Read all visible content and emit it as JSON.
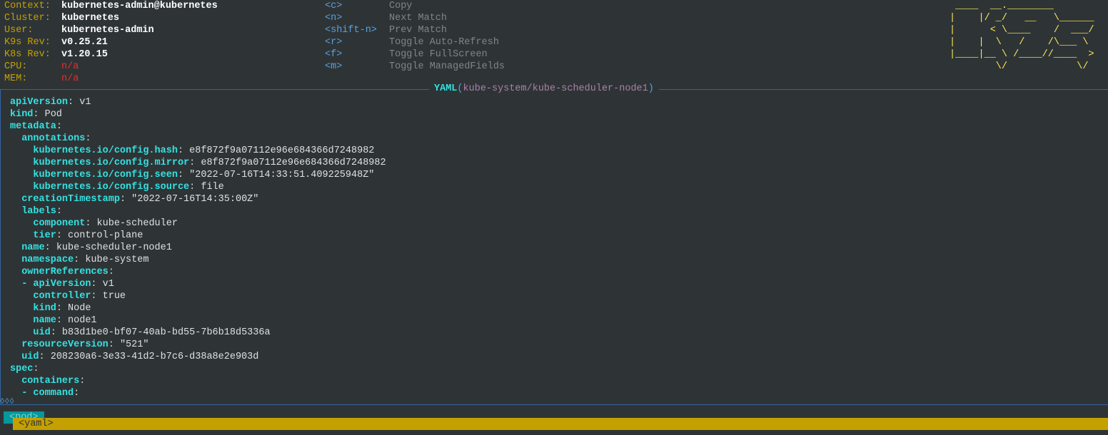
{
  "cluster_info": [
    {
      "label": "Context:",
      "value": "kubernetes-admin@kubernetes",
      "style": "bold"
    },
    {
      "label": "Cluster:",
      "value": "kubernetes",
      "style": "bold"
    },
    {
      "label": "User:",
      "value": "kubernetes-admin",
      "style": "bold"
    },
    {
      "label": "K9s Rev:",
      "value": "v0.25.21",
      "style": "bold"
    },
    {
      "label": "K8s Rev:",
      "value": "v1.20.15",
      "style": "bold"
    },
    {
      "label": "CPU:",
      "value": "n/a",
      "style": "na"
    },
    {
      "label": "MEM:",
      "value": "n/a",
      "style": "na"
    }
  ],
  "hints": [
    {
      "key": "<c>",
      "desc": "Copy"
    },
    {
      "key": "<n>",
      "desc": "Next Match"
    },
    {
      "key": "<shift-n>",
      "desc": "Prev Match"
    },
    {
      "key": "<r>",
      "desc": "Toggle Auto-Refresh"
    },
    {
      "key": "<f>",
      "desc": "Toggle FullScreen"
    },
    {
      "key": "<m>",
      "desc": "Toggle ManagedFields"
    }
  ],
  "logo_art": " ____  __.________       \n|    |/ _/   __   \\______\n|      < \\____    /  ___/\n|    |  \\   /    /\\___ \\ \n|____|__ \\ /____//____  >\n        \\/            \\/ ",
  "view_title": {
    "main": "YAML",
    "open": "(",
    "path": "kube-system/kube-scheduler-node1",
    "close": ")"
  },
  "yaml_lines": [
    {
      "indent": "",
      "dash": false,
      "key": "apiVersion",
      "value": "v1"
    },
    {
      "indent": "",
      "dash": false,
      "key": "kind",
      "value": "Pod"
    },
    {
      "indent": "",
      "dash": false,
      "key": "metadata",
      "value": ""
    },
    {
      "indent": "  ",
      "dash": false,
      "key": "annotations",
      "value": ""
    },
    {
      "indent": "    ",
      "dash": false,
      "key": "kubernetes.io/config.hash",
      "value": "e8f872f9a07112e96e684366d7248982"
    },
    {
      "indent": "    ",
      "dash": false,
      "key": "kubernetes.io/config.mirror",
      "value": "e8f872f9a07112e96e684366d7248982"
    },
    {
      "indent": "    ",
      "dash": false,
      "key": "kubernetes.io/config.seen",
      "value": "\"2022-07-16T14:33:51.409225948Z\""
    },
    {
      "indent": "    ",
      "dash": false,
      "key": "kubernetes.io/config.source",
      "value": "file"
    },
    {
      "indent": "  ",
      "dash": false,
      "key": "creationTimestamp",
      "value": "\"2022-07-16T14:35:00Z\""
    },
    {
      "indent": "  ",
      "dash": false,
      "key": "labels",
      "value": ""
    },
    {
      "indent": "    ",
      "dash": false,
      "key": "component",
      "value": "kube-scheduler"
    },
    {
      "indent": "    ",
      "dash": false,
      "key": "tier",
      "value": "control-plane"
    },
    {
      "indent": "  ",
      "dash": false,
      "key": "name",
      "value": "kube-scheduler-node1"
    },
    {
      "indent": "  ",
      "dash": false,
      "key": "namespace",
      "value": "kube-system"
    },
    {
      "indent": "  ",
      "dash": false,
      "key": "ownerReferences",
      "value": ""
    },
    {
      "indent": "  ",
      "dash": true,
      "key": "apiVersion",
      "value": "v1"
    },
    {
      "indent": "    ",
      "dash": false,
      "key": "controller",
      "value": "true"
    },
    {
      "indent": "    ",
      "dash": false,
      "key": "kind",
      "value": "Node"
    },
    {
      "indent": "    ",
      "dash": false,
      "key": "name",
      "value": "node1"
    },
    {
      "indent": "    ",
      "dash": false,
      "key": "uid",
      "value": "b83d1be0-bf07-40ab-bd55-7b6b18d5336a"
    },
    {
      "indent": "  ",
      "dash": false,
      "key": "resourceVersion",
      "value": "\"521\""
    },
    {
      "indent": "  ",
      "dash": false,
      "key": "uid",
      "value": "208230a6-3e33-41d2-b7c6-d38a8e2e903d"
    },
    {
      "indent": "",
      "dash": false,
      "key": "spec",
      "value": ""
    },
    {
      "indent": "  ",
      "dash": false,
      "key": "containers",
      "value": ""
    },
    {
      "indent": "  ",
      "dash": true,
      "key": "command",
      "value": ""
    }
  ],
  "scroll_indicator": "◊◊◊",
  "breadcrumbs": {
    "pod": "<pod>",
    "yaml": "<yaml>"
  },
  "colors": {
    "background": "#2e3436",
    "label": "#c4a000",
    "yaml_key": "#34e2e2",
    "hint_key": "#5aa0e0",
    "hint_desc": "#7f8588",
    "error": "#ef2929",
    "logo": "#fce94f",
    "border": "#3465a4"
  }
}
